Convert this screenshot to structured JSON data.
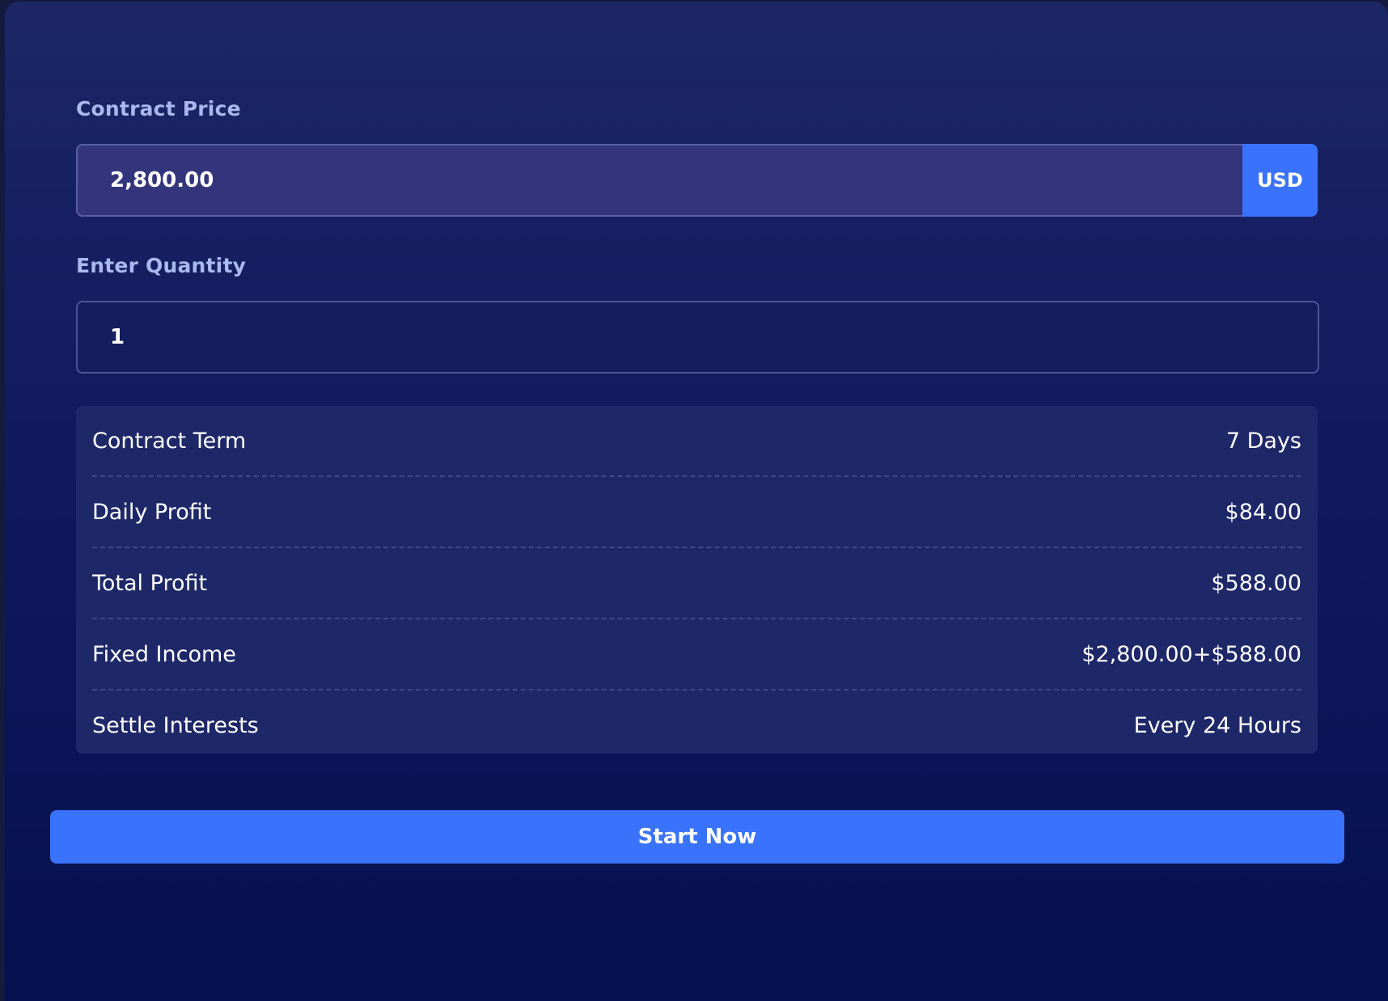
{
  "form": {
    "price_label": "Contract Price",
    "price_value": "2,800.00",
    "currency": "USD",
    "quantity_label": "Enter Quantity",
    "quantity_value": "1"
  },
  "details": [
    {
      "label": "Contract Term",
      "value": "7 Days"
    },
    {
      "label": "Daily Profit",
      "value": "$84.00"
    },
    {
      "label": "Total Profit",
      "value": "$588.00"
    },
    {
      "label": "Fixed Income",
      "value": "$2,800.00+$588.00"
    },
    {
      "label": "Settle Interests",
      "value": "Every 24 Hours"
    }
  ],
  "actions": {
    "start_label": "Start Now"
  },
  "colors": {
    "accent": "#3a73fb",
    "background_top": "#1c2766",
    "background_bottom": "#061150",
    "label_text": "#a9b8ee"
  }
}
